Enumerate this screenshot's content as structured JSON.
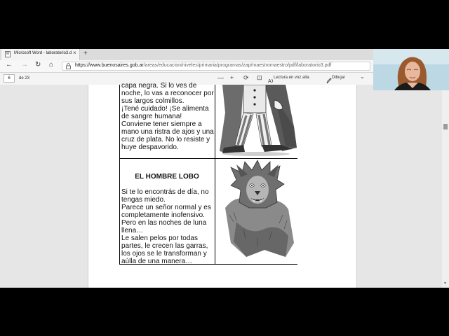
{
  "browser": {
    "tab_title": "Microsoft Word - laboratorio3.d",
    "tab_close": "×",
    "favicon": "doc-icon",
    "new_tab": "+",
    "nav": {
      "back": "←",
      "forward": "→",
      "reload": "↻",
      "home": "⌂"
    },
    "url_host": "https://www.buenosaires.gob.ar",
    "url_path": "/areas/educacion/niveles/primaria/programas/zap/maestromaestro/pdf/laboratorio3.pdf"
  },
  "pdf_toolbar": {
    "page_number": "6",
    "page_of": "de 23",
    "zoom_out": "—",
    "zoom_in": "+",
    "rotate": "⟳",
    "fit": "⊡",
    "read_aloud": "Lectura en voz alta",
    "draw": "Dibujar",
    "draw_chevron": "⌄"
  },
  "document": {
    "vampire_lines": [
      "capa negra. Si lo ves de",
      "noche, lo vas a reconocer por",
      "sus largos colmillos.",
      "¡Tené cuidado! ¡Se alimenta",
      "de sangre humana!",
      "Conviene tener siempre a",
      "mano una ristra de ajos y una",
      "cruz de plata. No lo resiste y",
      "huye despavorido."
    ],
    "wolf_title": "EL HOMBRE LOBO",
    "wolf_lines": [
      "Si te lo encontrás de día, no",
      "tengas miedo.",
      "Parece un señor normal y es",
      "completamente inofensivo.",
      "Pero en las noches de luna",
      "llena…",
      "Le salen pelos por todas",
      "partes, le crecen las garras,",
      "los ojos se le transforman y",
      "aúlla de una manera…"
    ]
  }
}
